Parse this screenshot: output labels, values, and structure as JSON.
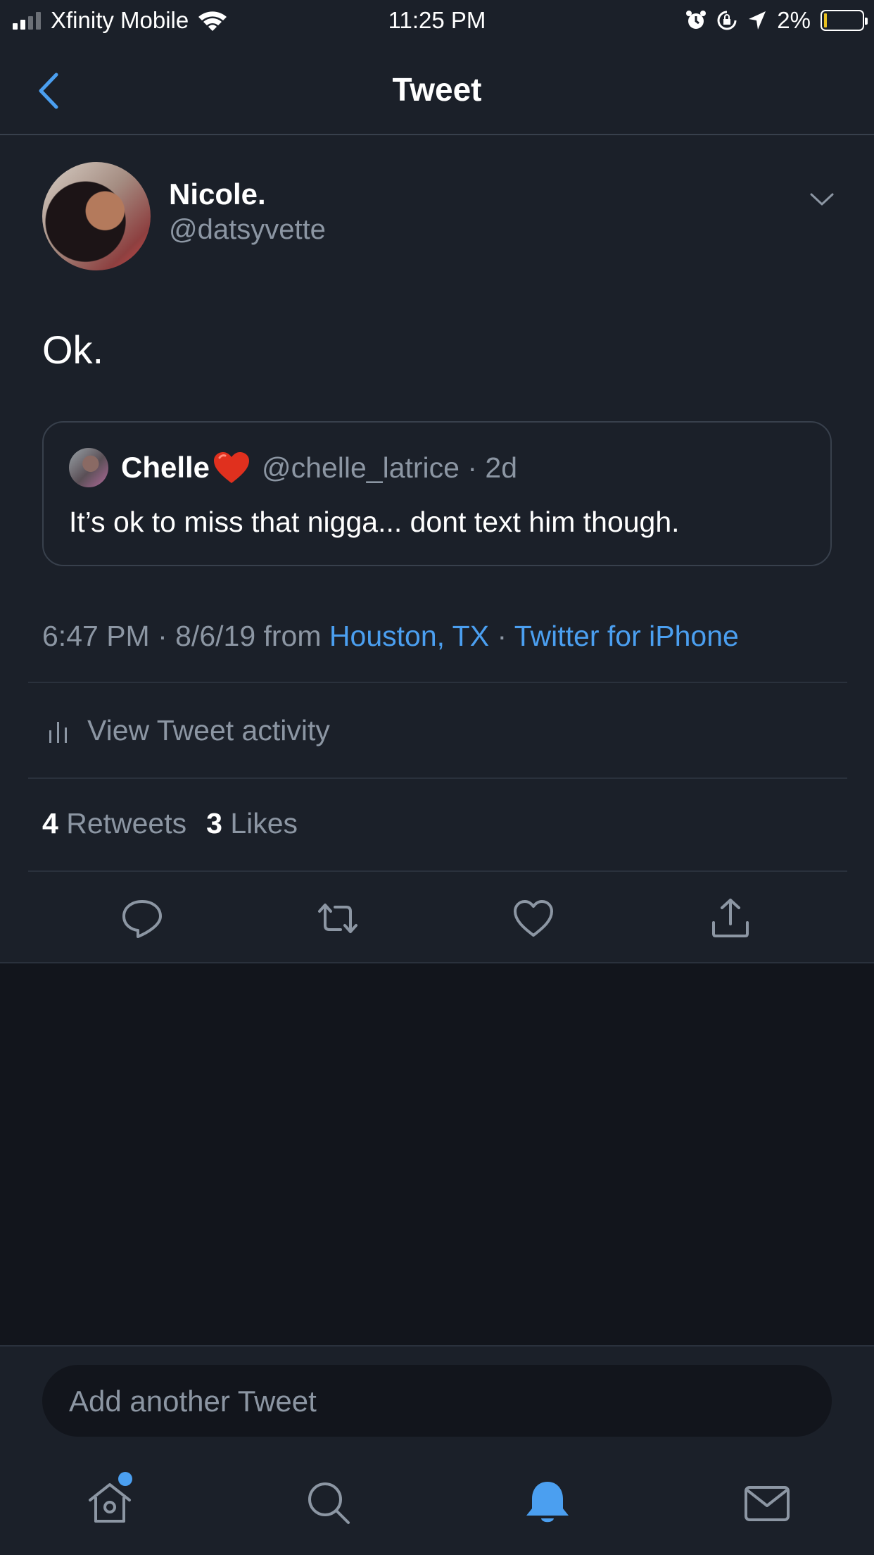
{
  "status_bar": {
    "carrier": "Xfinity Mobile",
    "time": "11:25 PM",
    "battery_percent": "2%",
    "battery_level": 0.02
  },
  "nav": {
    "title": "Tweet"
  },
  "tweet": {
    "author_name": "Nicole.",
    "author_handle": "@datsyvette",
    "text": "Ok.",
    "quoted": {
      "name": "Chelle",
      "handle_time": "@chelle_latrice · 2d",
      "text": "It’s ok to miss that nigga... dont text him though."
    },
    "meta": {
      "time_date": "6:47 PM · 8/6/19 from ",
      "location": "Houston, TX",
      "separator": " · ",
      "source": "Twitter for iPhone"
    },
    "activity_label": "View Tweet activity",
    "stats": {
      "retweets_count": "4",
      "retweets_label": " Retweets",
      "likes_count": "3",
      "likes_label": " Likes"
    }
  },
  "compose": {
    "placeholder": "Add another Tweet"
  },
  "icons": {
    "reply": "reply-icon",
    "retweet": "retweet-icon",
    "like": "heart-icon",
    "share": "share-icon",
    "home": "home-icon",
    "search": "search-icon",
    "notifications": "bell-icon",
    "messages": "mail-icon"
  },
  "colors": {
    "accent": "#4b9ff0",
    "background": "#1b2029",
    "secondary_text": "#8c96a3"
  }
}
